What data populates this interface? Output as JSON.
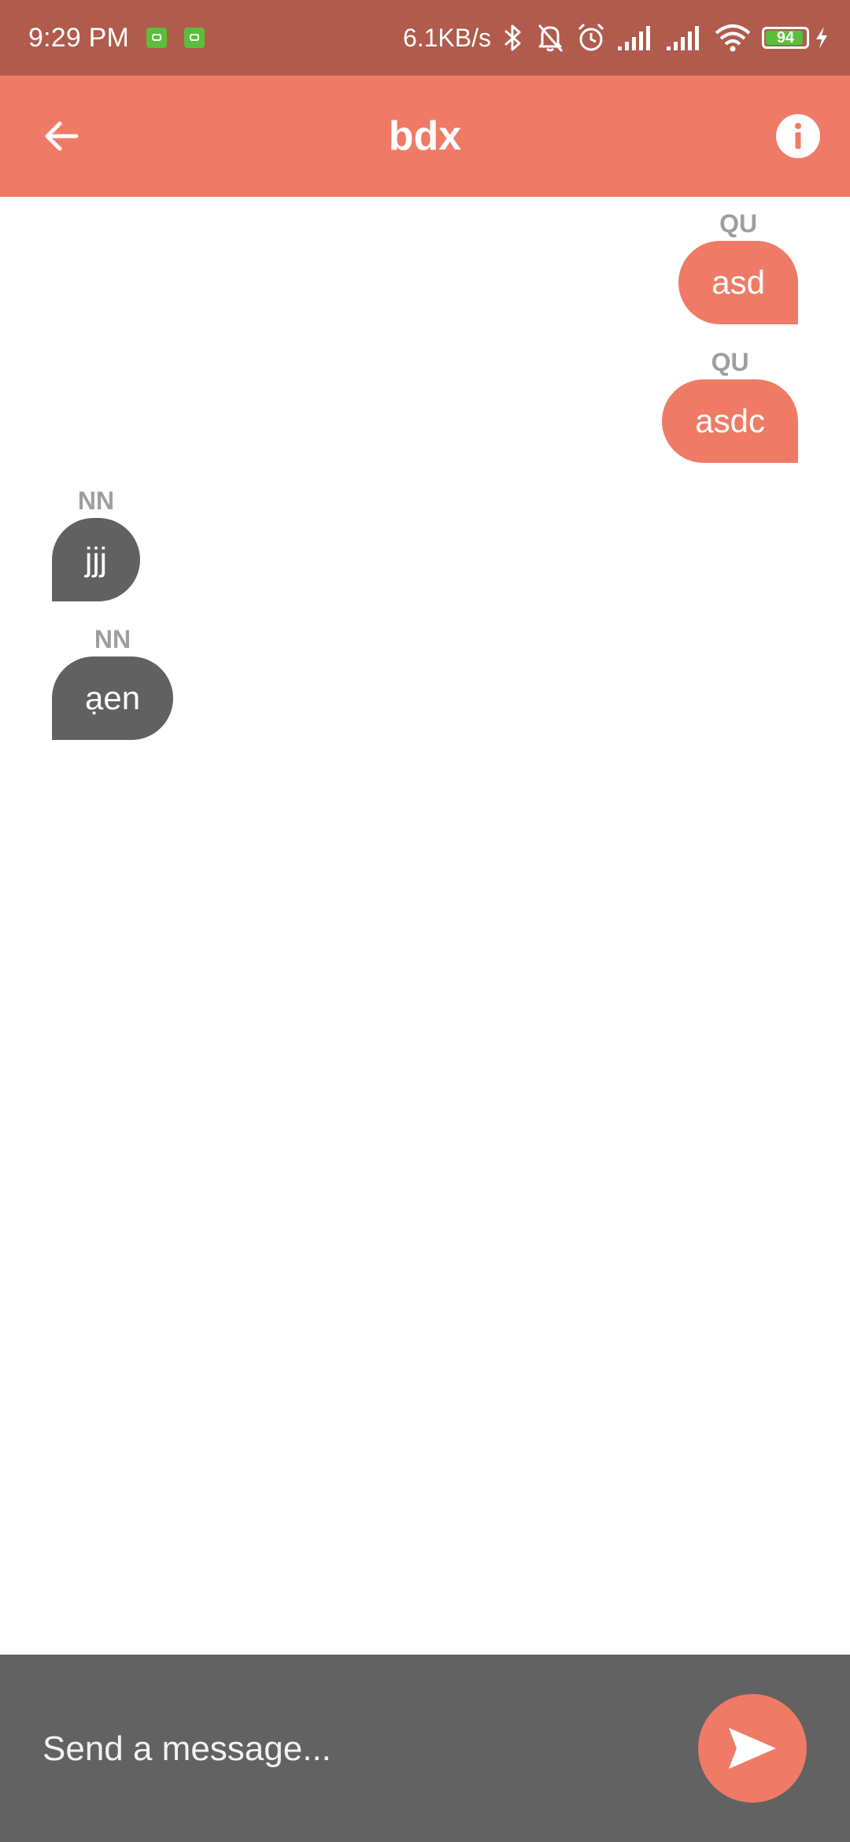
{
  "status_bar": {
    "time": "9:29 PM",
    "net_speed": "6.1KB/s",
    "battery_level": "94",
    "battery_fraction": 0.94,
    "icons": [
      "app-notification-icon",
      "app-notification-icon",
      "bluetooth-icon",
      "bell-off-icon",
      "alarm-icon",
      "signal-icon",
      "signal-icon",
      "wifi-icon",
      "battery-icon",
      "charging-icon"
    ]
  },
  "header": {
    "title": "bdx",
    "back_icon": "arrow-left-icon",
    "info_icon": "info-icon"
  },
  "messages": [
    {
      "sender": "QU",
      "text": "asd",
      "direction": "outgoing"
    },
    {
      "sender": "QU",
      "text": "asdc",
      "direction": "outgoing"
    },
    {
      "sender": "NN",
      "text": "jjj",
      "direction": "incoming"
    },
    {
      "sender": "NN",
      "text": "ạen",
      "direction": "incoming"
    }
  ],
  "composer": {
    "placeholder": "Send a message...",
    "value": "",
    "send_icon": "send-icon"
  },
  "colors": {
    "status_bar": "#B05B4C",
    "accent": "#EF7B66",
    "incoming_bubble": "#616161",
    "composer_bg": "#626262",
    "sender_label": "#9E9E9E"
  }
}
